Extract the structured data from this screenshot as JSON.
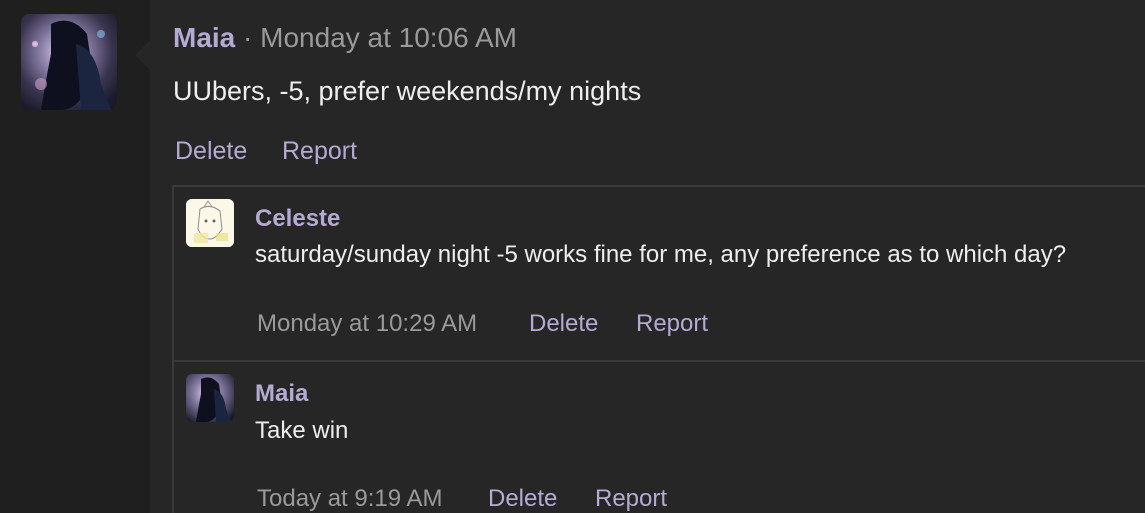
{
  "post": {
    "author": "Maia",
    "separator": "·",
    "timestamp": "Monday at 10:06 AM",
    "body": "UUbers, -5, prefer weekends/my nights",
    "delete_label": "Delete",
    "report_label": "Report"
  },
  "replies": [
    {
      "author": "Celeste",
      "text": "saturday/sunday night -5 works fine for me, any preference as to which day?",
      "timestamp": "Monday at 10:29 AM",
      "delete_label": "Delete",
      "report_label": "Report"
    },
    {
      "author": "Maia",
      "text": "Take win",
      "timestamp": "Today at 9:19 AM",
      "delete_label": "Delete",
      "report_label": "Report"
    }
  ],
  "colors": {
    "accent": "#b4aad2",
    "text": "#eeeeee",
    "muted": "#9a9a9a",
    "background": "#262626"
  }
}
